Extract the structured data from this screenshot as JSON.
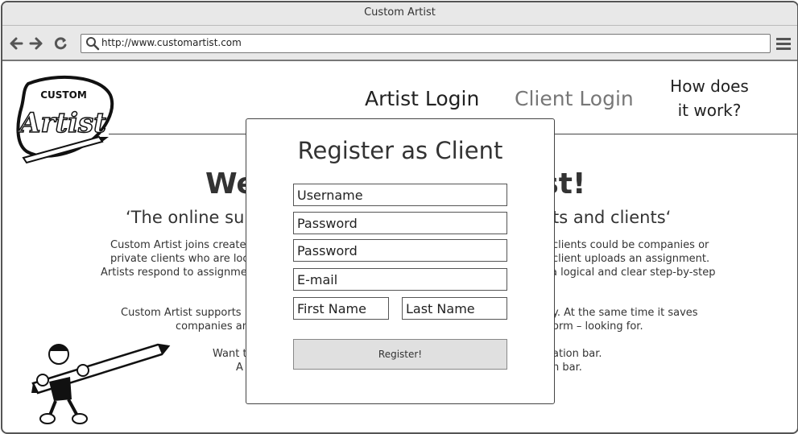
{
  "window": {
    "title": "Custom Artist"
  },
  "browser": {
    "url": "http://www.customartist.com",
    "back_icon": "arrow-left-icon",
    "forward_icon": "arrow-right-icon",
    "reload_icon": "reload-icon",
    "search_icon": "search-icon",
    "menu_icon": "hamburger-menu-icon"
  },
  "logo": {
    "top": "CUSTOM",
    "main": "Artist"
  },
  "nav": {
    "artist_login": "Artist Login",
    "client_login": "Client Login",
    "how_line1": "How does",
    "how_line2": "it work?"
  },
  "background": {
    "heading_left": "We",
    "heading_right": "ist!",
    "tagline_left": "‘The online su",
    "tagline_right": "ts and clients‘",
    "para1": [
      {
        "left": "Custom Artist joins create",
        "right": "clients could be companies or"
      },
      {
        "left": "private clients who are look",
        "right": "client uploads an assignment."
      },
      {
        "left": "Artists respond to assignme",
        "right": "a logical and clear step-by-step"
      }
    ],
    "para2": [
      {
        "left": "Custom Artist supports",
        "right": "y. At the same time it saves"
      },
      {
        "left": "companies an",
        "right": "orm – looking for."
      }
    ],
    "para3": [
      {
        "left": "Want t",
        "right": "ation bar."
      },
      {
        "left": "A",
        "right": "n bar."
      }
    ]
  },
  "modal": {
    "title": "Register as Client",
    "username_placeholder": "Username",
    "password_placeholder": "Password",
    "password_confirm_placeholder": "Password",
    "email_placeholder": "E-mail",
    "first_name_placeholder": "First Name",
    "last_name_placeholder": "Last Name",
    "register_label": "Register!"
  }
}
